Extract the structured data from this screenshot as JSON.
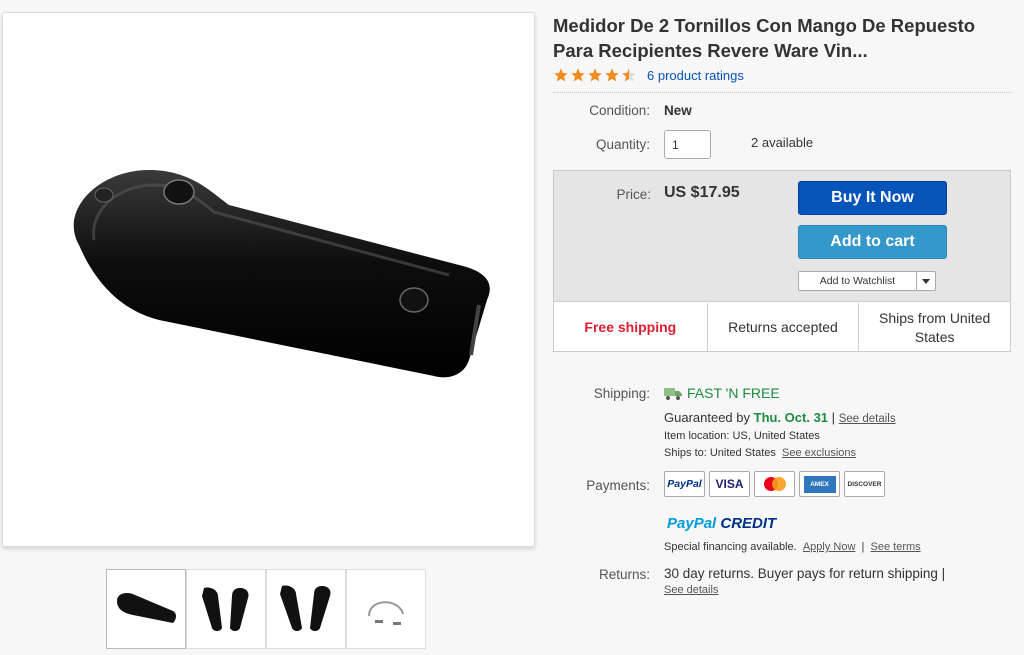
{
  "product": {
    "title": "Medidor De 2 Tornillos Con Mango De Repuesto Para Recipientes Revere Ware Vin...",
    "rating_stars": 4.5,
    "ratings_link": "6 product ratings"
  },
  "condition": {
    "label": "Condition:",
    "value": "New"
  },
  "quantity": {
    "label": "Quantity:",
    "value": "1",
    "available": "2 available"
  },
  "price": {
    "label": "Price:",
    "value": "US $17.95"
  },
  "buttons": {
    "buy_now": "Buy It Now",
    "add_to_cart": "Add to cart",
    "watchlist": "Add to Watchlist"
  },
  "highlights": {
    "free_shipping": "Free shipping",
    "returns": "Returns accepted",
    "ships_from": "Ships from United States"
  },
  "shipping": {
    "label": "Shipping:",
    "fast": "FAST 'N FREE",
    "guaranteed_prefix": "Guaranteed by",
    "guaranteed_date": "Thu. Oct. 31",
    "separator": "|",
    "see_details": "See details",
    "item_location": "Item location:  US, United States",
    "ships_to": "Ships to:  United States",
    "see_exclusions": "See exclusions"
  },
  "payments": {
    "label": "Payments:",
    "cards": [
      "PayPal",
      "VISA",
      "MasterCard",
      "AMEX",
      "DISCOVER"
    ],
    "paypal_credit_a": "PayPal",
    "paypal_credit_b": "CREDIT",
    "financing": "Special financing available.",
    "apply_now": "Apply Now",
    "pipe": "|",
    "see_terms": "See terms"
  },
  "returns": {
    "label": "Returns:",
    "text": "30 day returns. Buyer pays for return shipping |",
    "see_details": "See details"
  },
  "colors": {
    "buy_now": "#0654ba",
    "add_to_cart": "#3498ca",
    "free_shipping": "#dd1e31",
    "fast_green": "#1e8b3e",
    "star": "#f18c1e"
  }
}
